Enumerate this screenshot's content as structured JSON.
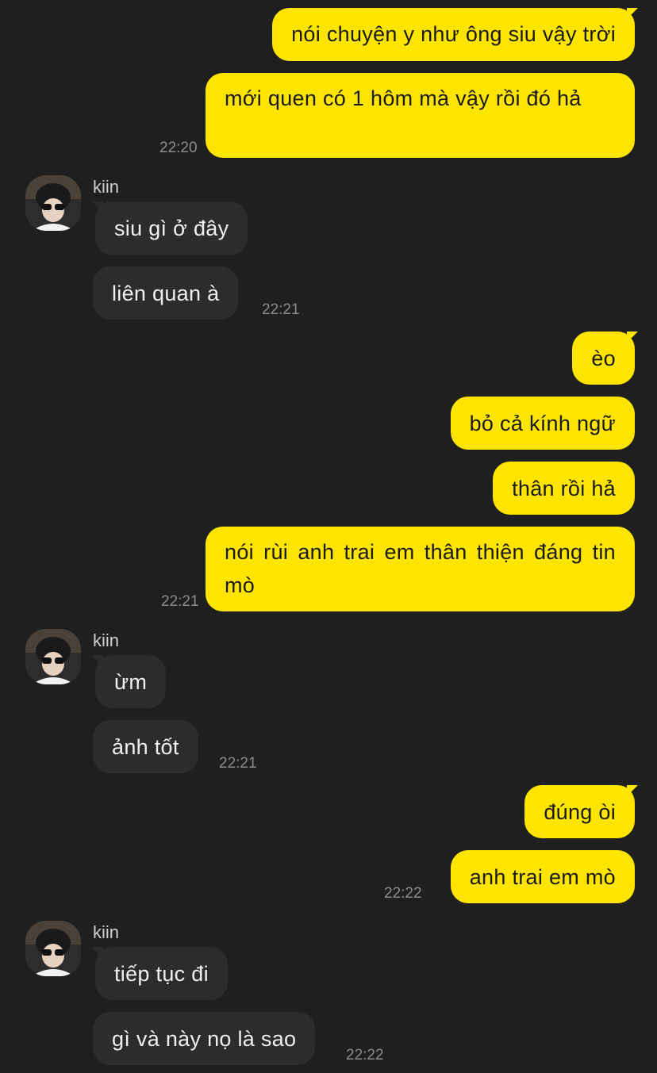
{
  "chat": {
    "contact_name": "kiin",
    "colors": {
      "my_bubble": "#fee500",
      "their_bubble": "#2c2c2c",
      "background": "#1f1f1f"
    },
    "messages": [
      {
        "from": "me",
        "text": "nói chuyện y như ông siu vậy trời"
      },
      {
        "from": "me",
        "text": "mới quen có 1 hôm mà vậy rồi đó hả",
        "time": "22:20"
      },
      {
        "from": "them",
        "text": "siu gì ở đây"
      },
      {
        "from": "them",
        "text": "liên quan à",
        "time": "22:21"
      },
      {
        "from": "me",
        "text": "èo"
      },
      {
        "from": "me",
        "text": "bỏ cả kính ngữ"
      },
      {
        "from": "me",
        "text": "thân rồi hả"
      },
      {
        "from": "me",
        "text": "nói rùi anh trai em thân thiện đáng tin mò",
        "time": "22:21"
      },
      {
        "from": "them",
        "text": "ừm"
      },
      {
        "from": "them",
        "text": "ảnh tốt",
        "time": "22:21"
      },
      {
        "from": "me",
        "text": "đúng òi"
      },
      {
        "from": "me",
        "text": "anh trai em mò",
        "time": "22:22"
      },
      {
        "from": "them",
        "text": "tiếp tục đi"
      },
      {
        "from": "them",
        "text": "gì và này nọ là sao",
        "time": "22:22"
      }
    ]
  }
}
